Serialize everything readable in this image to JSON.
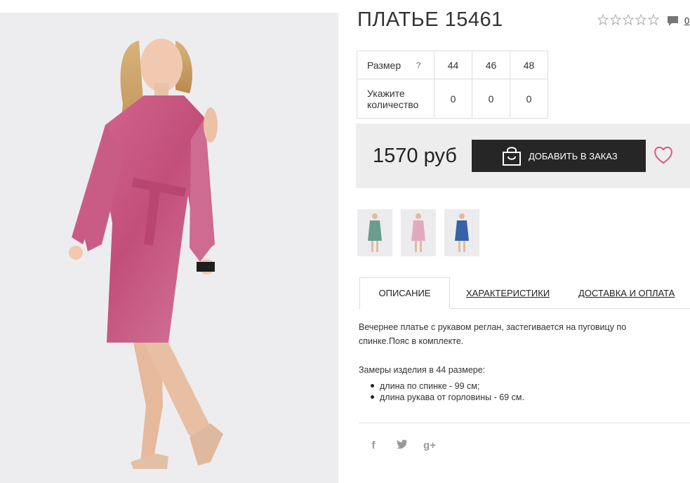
{
  "product": {
    "title": "ПЛАТЬЕ 15461",
    "rating": 0,
    "rating_max": 5,
    "comments_count": "0",
    "main_image_icon": "photo-dress-pink"
  },
  "size_table": {
    "size_label": "Размер",
    "size_help": "?",
    "sizes": [
      "44",
      "46",
      "48"
    ],
    "quantity_label": "Укажите количество",
    "quantities": [
      "0",
      "0",
      "0"
    ]
  },
  "purchase": {
    "price": "1570 руб",
    "add_button_label": "ДОБАВИТЬ В ЗАКАЗ",
    "bag_icon": "shopping-bag-icon",
    "favorite_icon": "heart-icon",
    "heart_color": "#d65c8a"
  },
  "thumbnails": [
    {
      "name": "thumb-green",
      "color": "#6a9d8e"
    },
    {
      "name": "thumb-pink",
      "color": "#e3a9bf"
    },
    {
      "name": "thumb-blue",
      "color": "#3563a8"
    }
  ],
  "tabs": [
    {
      "label": "ОПИСАНИЕ",
      "active": true
    },
    {
      "label": "ХАРАКТЕРИСТИКИ",
      "active": false
    },
    {
      "label": "ДОСТАВКА И ОПЛАТА",
      "active": false
    }
  ],
  "description": {
    "text": "Вечернее платье с рукавом реглан, застегивается на пуговицу по спинке.Пояс в комплекте.",
    "measurements_title": "Замеры изделия в 44 размере:",
    "measurements": [
      "длина по спинке - 99 см;",
      "длина рукава от горловины - 69 см."
    ]
  },
  "social": [
    {
      "name": "facebook-icon",
      "glyph": "f"
    },
    {
      "name": "twitter-icon",
      "glyph": "t"
    },
    {
      "name": "google-plus-icon",
      "glyph": "g+"
    }
  ],
  "colors": {
    "dress": "#c9537c",
    "button_bg": "#262626",
    "price_box_bg": "#ededed"
  }
}
